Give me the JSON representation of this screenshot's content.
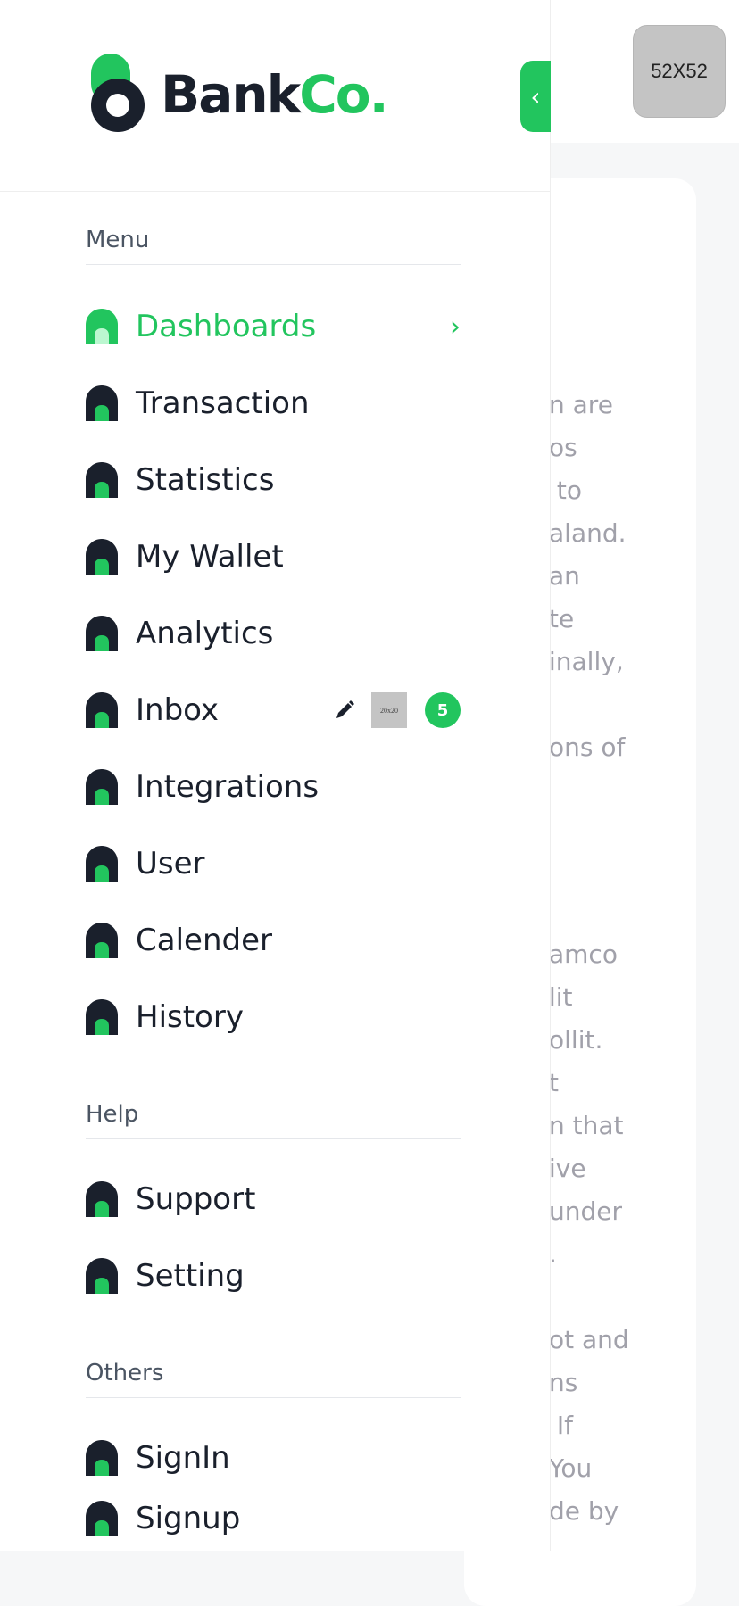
{
  "brand": {
    "part1": "Bank",
    "part2": "Co."
  },
  "header": {
    "avatar_placeholder": "52X52"
  },
  "colors": {
    "accent": "#22c55e",
    "dark": "#1a202c",
    "muted": "#a1a1aa"
  },
  "sidebar": {
    "collapse_icon": "chevron-left-icon",
    "sections": {
      "menu": "Menu",
      "help": "Help",
      "others": "Others"
    },
    "menu_items": [
      {
        "label": "Dashboards",
        "icon": "home-icon",
        "active": true
      },
      {
        "label": "Transaction",
        "icon": "home-icon"
      },
      {
        "label": "Statistics",
        "icon": "home-icon"
      },
      {
        "label": "My Wallet",
        "icon": "home-icon"
      },
      {
        "label": "Analytics",
        "icon": "home-icon"
      },
      {
        "label": "Inbox",
        "icon": "home-icon",
        "image_placeholder": "20x20",
        "badge": "5"
      },
      {
        "label": "Integrations",
        "icon": "home-icon"
      },
      {
        "label": "User",
        "icon": "home-icon"
      },
      {
        "label": "Calender",
        "icon": "home-icon"
      },
      {
        "label": "History",
        "icon": "home-icon"
      }
    ],
    "help_items": [
      {
        "label": "Support",
        "icon": "home-icon"
      },
      {
        "label": "Setting",
        "icon": "home-icon"
      }
    ],
    "other_items": [
      {
        "label": "SignIn",
        "icon": "home-icon"
      },
      {
        "label": "Signup",
        "icon": "home-icon"
      }
    ]
  },
  "content": {
    "para1": [
      "n are",
      "os",
      " to",
      "aland.",
      "an",
      "te",
      "inally,",
      "",
      "ons of"
    ],
    "para2": [
      "amco",
      "lit",
      "ollit.",
      "t",
      "n that",
      "ive",
      "under",
      "."
    ],
    "para3": [
      "ot and",
      "ns",
      " If",
      "You",
      "de by"
    ]
  }
}
